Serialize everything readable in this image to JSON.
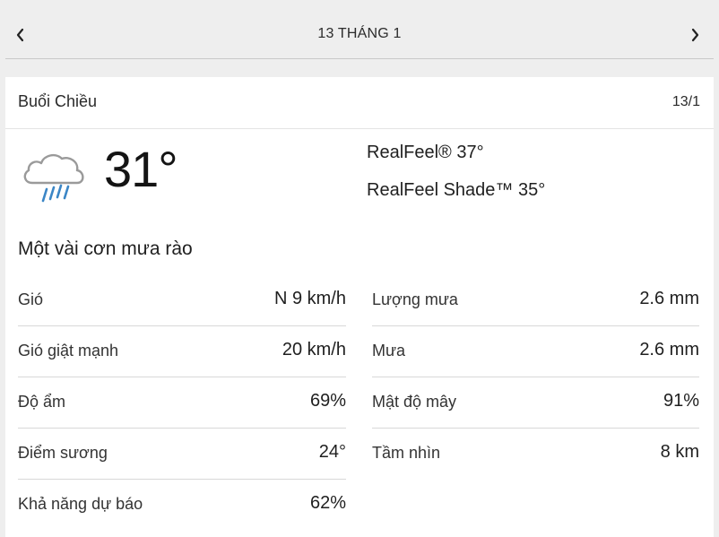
{
  "nav": {
    "title": "13 THÁNG 1",
    "prev_icon": "chevron-left-icon",
    "next_icon": "chevron-right-icon"
  },
  "header": {
    "period": "Buổi Chiều",
    "date": "13/1"
  },
  "current": {
    "temperature": "31°",
    "icon": "cloud-rain-icon",
    "realfeel": "RealFeel® 37°",
    "realfeel_shade": "RealFeel Shade™ 35°",
    "phrase": "Một vài cơn mưa rào"
  },
  "details_left": [
    {
      "label": "Gió",
      "value": "N 9 km/h"
    },
    {
      "label": "Gió giật mạnh",
      "value": "20 km/h"
    },
    {
      "label": "Độ ẩm",
      "value": "69%"
    },
    {
      "label": "Điểm sương",
      "value": "24°"
    },
    {
      "label": "Khả năng dự báo",
      "value": "62%"
    }
  ],
  "details_right": [
    {
      "label": "Lượng mưa",
      "value": "2.6 mm"
    },
    {
      "label": "Mưa",
      "value": "2.6 mm"
    },
    {
      "label": "Mật độ mây",
      "value": "91%"
    },
    {
      "label": "Tầm nhìn",
      "value": "8 km"
    }
  ],
  "colors": {
    "background": "#eeeeee",
    "card": "#ffffff",
    "rain": "#3b86c6",
    "cloud_outline": "#9a9a9a"
  }
}
